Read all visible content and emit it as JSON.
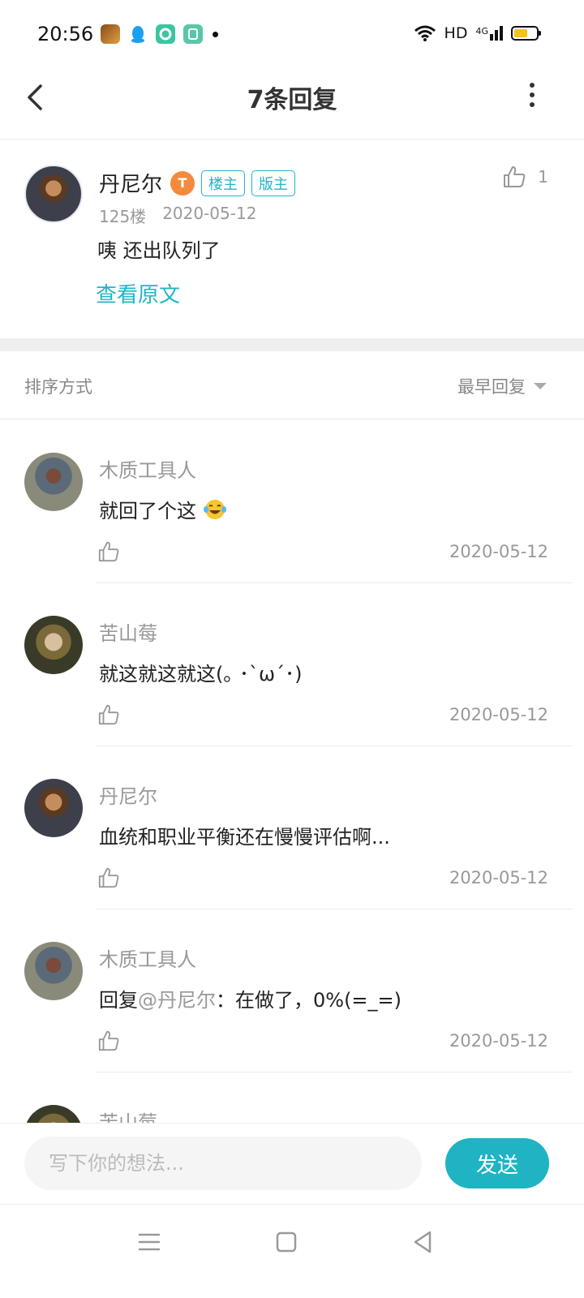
{
  "status_bar": {
    "time": "20:56",
    "network": "HD",
    "signal": "4G",
    "apps": [
      "game-app-icon",
      "qq-icon",
      "green-app-icon",
      "green-app-icon-2"
    ]
  },
  "nav": {
    "title": "7条回复"
  },
  "main_post": {
    "author": "丹尼尔",
    "level_badge": "T",
    "tags": [
      "楼主",
      "版主"
    ],
    "floor": "125楼",
    "date": "2020-05-12",
    "content": "咦 还出队列了",
    "view_original": "查看原文",
    "like_count": "1"
  },
  "sort": {
    "label": "排序方式",
    "selected": "最早回复"
  },
  "replies": [
    {
      "author": "木质工具人",
      "text": "就回了个这",
      "emoji": "tears-of-joy-emoji",
      "date": "2020-05-12"
    },
    {
      "author": "苦山莓",
      "text": "就这就这就这(｡ ･`ω´･)",
      "date": "2020-05-12"
    },
    {
      "author": "丹尼尔",
      "text": "血统和职业平衡还在慢慢评估啊...",
      "date": "2020-05-12"
    },
    {
      "author": "木质工具人",
      "prefix": "回复",
      "mention": "@丹尼尔",
      "text": "：在做了，0%(=_=)",
      "date": "2020-05-12"
    },
    {
      "author": "苦山莓"
    }
  ],
  "input_bar": {
    "placeholder": "写下你的想法...",
    "send_label": "发送"
  },
  "colors": {
    "accent": "#1fb3c4",
    "level_badge": "#f58a3c"
  }
}
